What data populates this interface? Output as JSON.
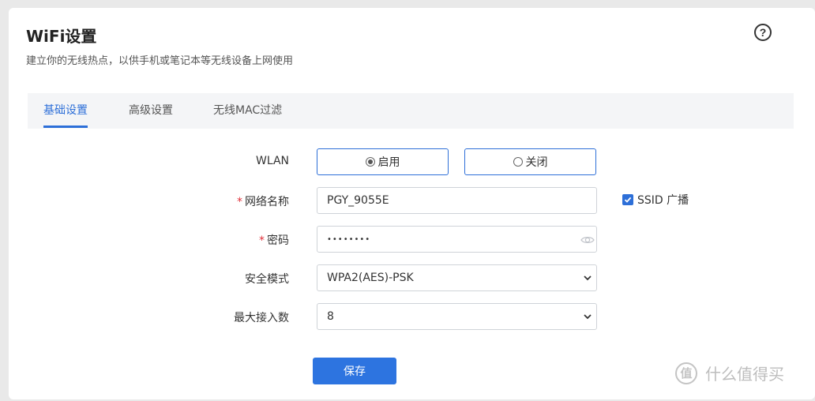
{
  "header": {
    "title": "WiFi设置",
    "subtitle": "建立你的无线热点，以供手机或笔记本等无线设备上网使用",
    "help_icon_glyph": "?"
  },
  "tabs": [
    {
      "label": "基础设置",
      "active": true
    },
    {
      "label": "高级设置",
      "active": false
    },
    {
      "label": "无线MAC过滤",
      "active": false
    }
  ],
  "form": {
    "wlan": {
      "label": "WLAN",
      "options": [
        {
          "label": "启用",
          "selected": true
        },
        {
          "label": "关闭",
          "selected": false
        }
      ]
    },
    "ssid": {
      "required_mark": "*",
      "label": "网络名称",
      "value": "PGY_9055E",
      "broadcast_label": "SSID 广播",
      "broadcast_checked": true
    },
    "password": {
      "required_mark": "*",
      "label": "密码",
      "value": "••••••••"
    },
    "security_mode": {
      "label": "安全模式",
      "value": "WPA2(AES)-PSK"
    },
    "max_clients": {
      "label": "最大接入数",
      "value": "8"
    }
  },
  "actions": {
    "save_label": "保存"
  },
  "watermark": {
    "logo_glyph": "值",
    "text": "什么值得买"
  },
  "colors": {
    "accent": "#2d6fd8",
    "required": "#e0303a",
    "background": "#e9e9e9"
  }
}
